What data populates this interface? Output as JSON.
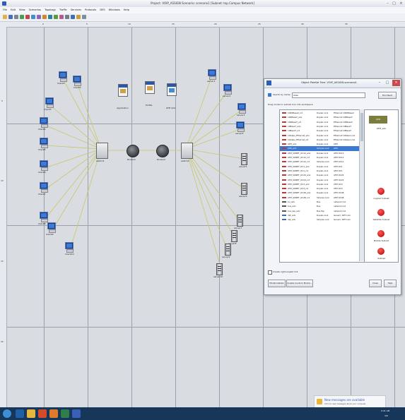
{
  "window": {
    "title": "Project: VOIP_ASSIGN Scenario: scenario1  [Subnet: top.Campus Network]",
    "minimize": "–",
    "maximize": "□",
    "close": "×"
  },
  "menu": [
    "File",
    "Edit",
    "View",
    "Scenarios",
    "Topology",
    "Traffic",
    "Services",
    "Protocols",
    "DES",
    "Windows",
    "Help"
  ],
  "ruler": {
    "h": [
      "0",
      "5",
      "10",
      "15",
      "20",
      "25",
      "30",
      "35"
    ],
    "v": [
      "5",
      "10",
      "15",
      "20"
    ]
  },
  "config": {
    "app": "Application",
    "profile": "Profile",
    "atm": "ATM QoS"
  },
  "clients": [
    "Client1",
    "Client2",
    "Client3",
    "Client4",
    "Client5",
    "Client6",
    "Client7",
    "Client8",
    "Client9",
    "Client10"
  ],
  "servers": [
    "server1",
    "server2",
    "server3",
    "server4",
    "server5",
    "server6",
    "server7",
    "server8",
    "server9",
    "server10"
  ],
  "core": {
    "sw1": "switch1",
    "r1": "Router1",
    "r2": "Router2",
    "sw2": "switch2"
  },
  "palette": {
    "title": "Object Palette Tree: VOIP_ASSIGN-scenario1",
    "search_label": "Search by name:",
    "search_value": "links",
    "find_next": "Find Next",
    "drag_hint": "Drag model or subnet icon into workspace",
    "rows": [
      {
        "name": "1000BaseX_int",
        "type": "Duplex Link",
        "desc": "Ethernet 1000BaseX"
      },
      {
        "name": "100BaseT_adv",
        "type": "Duplex Link",
        "desc": "Ethernet 100BaseT"
      },
      {
        "name": "100BaseT_int",
        "type": "Duplex Link",
        "desc": "Ethernet 100BaseT"
      },
      {
        "name": "10BaseT_adv",
        "type": "Duplex Link",
        "desc": "Ethernet 10BaseT"
      },
      {
        "name": "10BaseT_int",
        "type": "Duplex Link",
        "desc": "Ethernet 10BaseT"
      },
      {
        "name": "10Gbps_Ethernet_adv",
        "type": "Duplex Link",
        "desc": "Ethernet 10Gbps Link"
      },
      {
        "name": "10Gbps_Ethernet_int",
        "type": "Duplex Link",
        "desc": "Ethernet 10Gbps Link"
      },
      {
        "name": "ATM_adv",
        "type": "Duplex Link",
        "desc": "ATM"
      },
      {
        "name": "ATM_adv",
        "type": "Simplex Link",
        "desc": "ATM"
      },
      {
        "name": "ATM_SONET_OC12_adv",
        "type": "Duplex Link",
        "desc": "ATM OC12"
      },
      {
        "name": "ATM_SONET_OC12_int",
        "type": "Duplex Link",
        "desc": "ATM OC12"
      },
      {
        "name": "ATM_SONET_OC12_int",
        "type": "Simplex Link",
        "desc": "ATM OC12"
      },
      {
        "name": "ATM_SONET_OC1_adv",
        "type": "Duplex Link",
        "desc": "ATM OC1"
      },
      {
        "name": "ATM_SONET_OC1_int",
        "type": "Duplex Link",
        "desc": "ATM OC1"
      },
      {
        "name": "ATM_SONET_OC24_adv",
        "type": "Duplex Link",
        "desc": "ATM OC24"
      },
      {
        "name": "ATM_SONET_OC24_int",
        "type": "Duplex Link",
        "desc": "ATM OC24"
      },
      {
        "name": "ATM_SONET_OC3_adv",
        "type": "Duplex Link",
        "desc": "ATM OC3"
      },
      {
        "name": "ATM_SONET_OC3_int",
        "type": "Duplex Link",
        "desc": "ATM OC3"
      },
      {
        "name": "ATM_SONET_OC48_adv",
        "type": "Duplex Link",
        "desc": "ATM OC48"
      },
      {
        "name": "ATM_SONET_OC48_int",
        "type": "Simplex Link",
        "desc": "ATM OC48"
      },
      {
        "name": "bu_adv",
        "type": "Bus",
        "desc": "network link"
      },
      {
        "name": "bus_adv",
        "type": "Bus",
        "desc": "network link"
      },
      {
        "name": "bus_tap_adv",
        "type": "Bus Tap",
        "desc": "network link"
      },
      {
        "name": "dpt_adv",
        "type": "Duplex Link",
        "desc": "Generic DPT Link"
      },
      {
        "name": "dpt_adv",
        "type": "Simplex Link",
        "desc": "Generic DPT Link"
      }
    ],
    "selected_index": 8,
    "preview_label": "ATM_adv",
    "preview_box": "ATM",
    "subnets": [
      "Logical Subnet",
      "Satellite Subnet",
      "Mobile Subnet",
      "Subnet"
    ],
    "checkbox_label": "Create right-angled link",
    "buttons": {
      "model_details": "Model Details",
      "create_custom": "Create Custom Model...",
      "close": "Close",
      "help": "Help"
    }
  },
  "notification": {
    "title": "New messages are available",
    "body": "Click to view messages about your computer."
  },
  "tray": {
    "time": "9:41 AM",
    "date": "3/9"
  },
  "colors": {
    "link": "#c8c56a",
    "taskbar": "#16365a",
    "selection": "#3a78d2"
  }
}
